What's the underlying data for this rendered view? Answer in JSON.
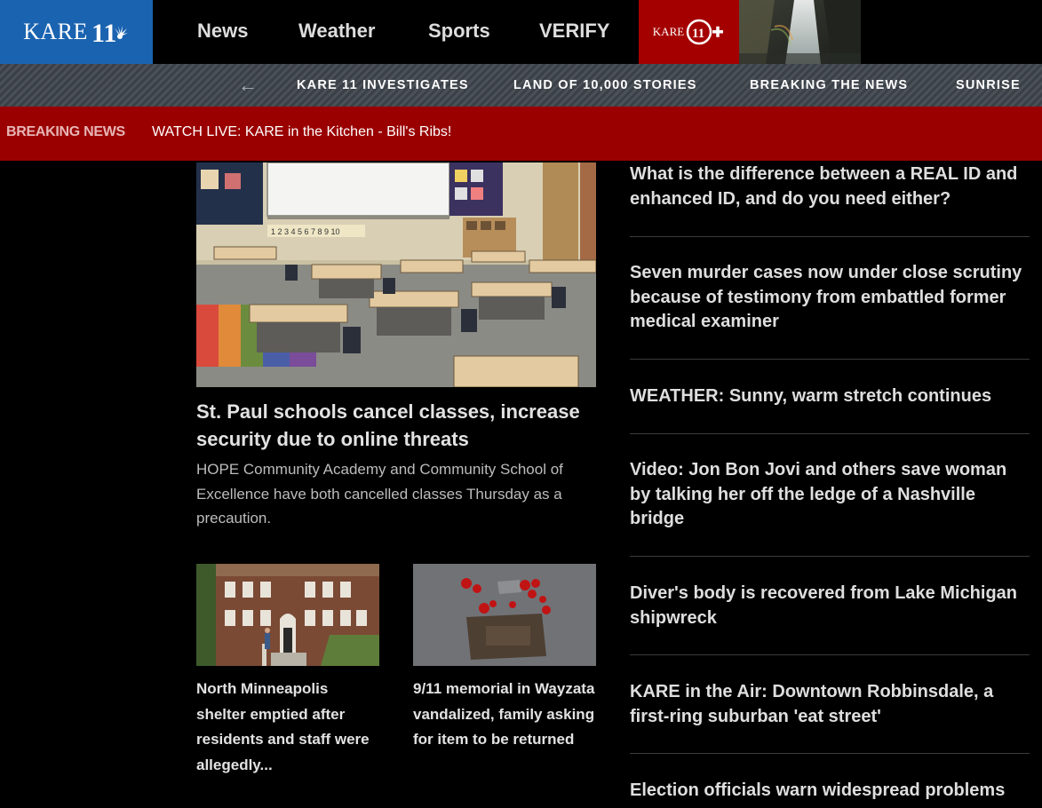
{
  "brand": {
    "logo_text": "KARE",
    "logo_number": "11",
    "plus_text": "KARE"
  },
  "nav": {
    "items": [
      {
        "label": "News"
      },
      {
        "label": "Weather"
      },
      {
        "label": "Sports"
      },
      {
        "label": "VERIFY"
      }
    ]
  },
  "subnav": {
    "items": [
      {
        "label": "KARE 11 INVESTIGATES"
      },
      {
        "label": "LAND OF 10,000 STORIES"
      },
      {
        "label": "BREAKING THE NEWS"
      },
      {
        "label": "SUNRISE"
      }
    ]
  },
  "breaking": {
    "label": "BREAKING NEWS",
    "text": "WATCH LIVE: KARE in the Kitchen - Bill's Ribs!"
  },
  "hero": {
    "board_numbers": "1 2 3 4 5 6 7 8 9 10",
    "title": "St. Paul schools cancel classes, increase security due to online threats",
    "summary": "HOPE Community Academy and Community School of Excellence have both cancelled classes Thursday as a precaution."
  },
  "cards": [
    {
      "title": "North Minneapolis shelter emptied after residents and staff were allegedly..."
    },
    {
      "title": "9/11 memorial in Wayzata vandalized, family asking for item to be returned"
    }
  ],
  "headlines": [
    {
      "title": "What is the difference between a REAL ID and enhanced ID, and do you need either?"
    },
    {
      "title": "Seven murder cases now under close scrutiny because of testimony from embattled former medical examiner"
    },
    {
      "title": "WEATHER: Sunny, warm stretch continues"
    },
    {
      "title": "Video: Jon Bon Jovi and others save woman by talking her off the ledge of a Nashville bridge"
    },
    {
      "title": "Diver's body is recovered from Lake Michigan shipwreck"
    },
    {
      "title": "KARE in the Air: Downtown Robbinsdale, a first-ring suburban 'eat street'"
    },
    {
      "title": "Election officials warn widespread problems"
    }
  ],
  "colors": {
    "logo_bg": "#1a63b0",
    "plus_bg": "#a50000",
    "breaking_bg": "#9a0000",
    "page_bg": "#000000"
  }
}
